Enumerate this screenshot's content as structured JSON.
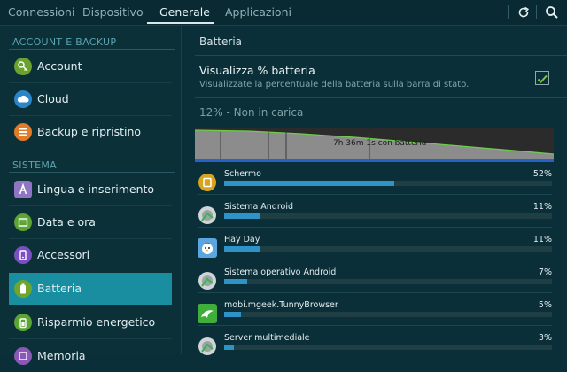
{
  "tabs": [
    {
      "label": "Connessioni",
      "active": false
    },
    {
      "label": "Dispositivo",
      "active": false
    },
    {
      "label": "Generale",
      "active": true
    },
    {
      "label": "Applicazioni",
      "active": false
    }
  ],
  "toolbar": {
    "icons": [
      "refresh-icon",
      "search-icon"
    ]
  },
  "sidebar": {
    "sections": [
      {
        "title": "ACCOUNT E BACKUP",
        "items": [
          {
            "label": "Account",
            "icon": "key-icon",
            "color": "#6aa22e"
          },
          {
            "label": "Cloud",
            "icon": "cloud-icon",
            "color": "#2a86c8"
          },
          {
            "label": "Backup e ripristino",
            "icon": "backup-icon",
            "color": "#e07b29"
          }
        ]
      },
      {
        "title": "SISTEMA",
        "items": [
          {
            "label": "Lingua e inserimento",
            "icon": "language-icon",
            "color": "#8e76c4"
          },
          {
            "label": "Data e ora",
            "icon": "clock-icon",
            "color": "#5ca434"
          },
          {
            "label": "Accessori",
            "icon": "accessories-icon",
            "color": "#7b4fc1"
          },
          {
            "label": "Batteria",
            "icon": "battery-icon",
            "color": "#6ea52c",
            "active": true
          },
          {
            "label": "Risparmio energetico",
            "icon": "power-saving-icon",
            "color": "#5ca434"
          },
          {
            "label": "Memoria",
            "icon": "memory-icon",
            "color": "#8a59b8"
          }
        ]
      }
    ]
  },
  "main": {
    "title": "Batteria",
    "option": {
      "title": "Visualizza % batteria",
      "description": "Visualizzate la percentuale della batteria sulla barra di stato.",
      "checked": true
    },
    "status": "12% - Non in carica",
    "graph_label": "7h 36m 1s con batteria",
    "usage": [
      {
        "name": "Schermo",
        "percent_label": "52%",
        "fraction": 0.52,
        "icon": "screen-icon"
      },
      {
        "name": "Sistema Android",
        "percent_label": "11%",
        "fraction": 0.11,
        "icon": "android-system-icon"
      },
      {
        "name": "Hay Day",
        "percent_label": "11%",
        "fraction": 0.11,
        "icon": "hay-day-icon"
      },
      {
        "name": "Sistema operativo Android",
        "percent_label": "7%",
        "fraction": 0.07,
        "icon": "android-os-icon"
      },
      {
        "name": "mobi.mgeek.TunnyBrowser",
        "percent_label": "5%",
        "fraction": 0.05,
        "icon": "dolphin-browser-icon"
      },
      {
        "name": "Server multimediale",
        "percent_label": "3%",
        "fraction": 0.03,
        "icon": "media-server-icon"
      }
    ]
  }
}
